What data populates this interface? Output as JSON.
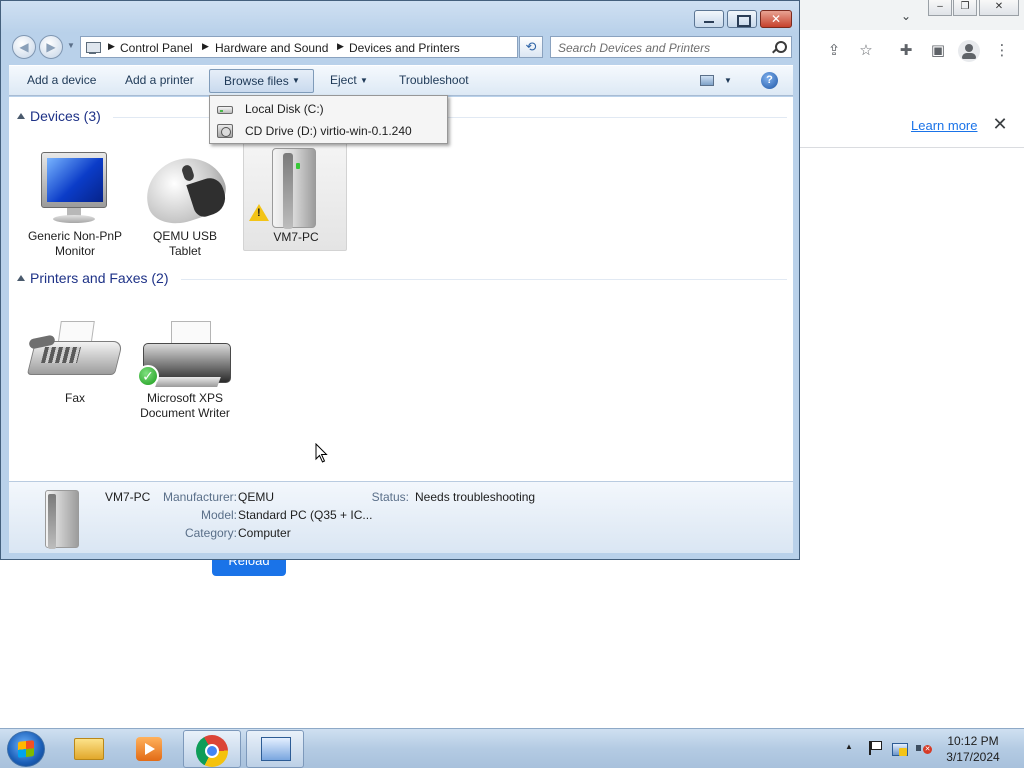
{
  "chrome": {
    "learn_more": "Learn more",
    "reload_button": "Reload"
  },
  "window": {
    "breadcrumb": [
      "Control Panel",
      "Hardware and Sound",
      "Devices and Printers"
    ],
    "search_placeholder": "Search Devices and Printers"
  },
  "commandbar": {
    "add_device": "Add a device",
    "add_printer": "Add a printer",
    "browse_files": "Browse files",
    "eject": "Eject",
    "troubleshoot": "Troubleshoot"
  },
  "browse_menu": {
    "items": [
      {
        "label": "Local Disk (C:)",
        "icon": "hard-disk-icon"
      },
      {
        "label": "CD Drive (D:) virtio-win-0.1.240",
        "icon": "cd-drive-icon"
      }
    ]
  },
  "groups": {
    "devices": {
      "title": "Devices (3)",
      "items": [
        {
          "label_line1": "Generic Non-PnP",
          "label_line2": "Monitor",
          "icon": "monitor-icon"
        },
        {
          "label_line1": "QEMU USB",
          "label_line2": "Tablet",
          "icon": "mouse-icon"
        },
        {
          "label_line1": "VM7-PC",
          "label_line2": "",
          "icon": "computer-icon",
          "selected": true,
          "warning": true
        }
      ]
    },
    "printers": {
      "title": "Printers and Faxes (2)",
      "items": [
        {
          "label_line1": "Fax",
          "label_line2": "",
          "icon": "fax-icon"
        },
        {
          "label_line1": "Microsoft XPS",
          "label_line2": "Document Writer",
          "icon": "printer-icon",
          "default": true
        }
      ]
    }
  },
  "details": {
    "name": "VM7-PC",
    "manufacturer_label": "Manufacturer:",
    "manufacturer": "QEMU",
    "model_label": "Model:",
    "model": "Standard PC (Q35 + IC...",
    "category_label": "Category:",
    "category": "Computer",
    "status_label": "Status:",
    "status": "Needs troubleshooting"
  },
  "taskbar": {
    "apps": [
      "windows-explorer-icon",
      "media-player-icon",
      "chrome-icon",
      "devices-and-printers-icon"
    ],
    "time": "10:12 PM",
    "date": "3/17/2024"
  },
  "colors": {
    "group_title": "#1e3287",
    "window_frame": "#b9d1ea",
    "warning": "#f3c417",
    "chrome_link": "#1a73e8"
  }
}
